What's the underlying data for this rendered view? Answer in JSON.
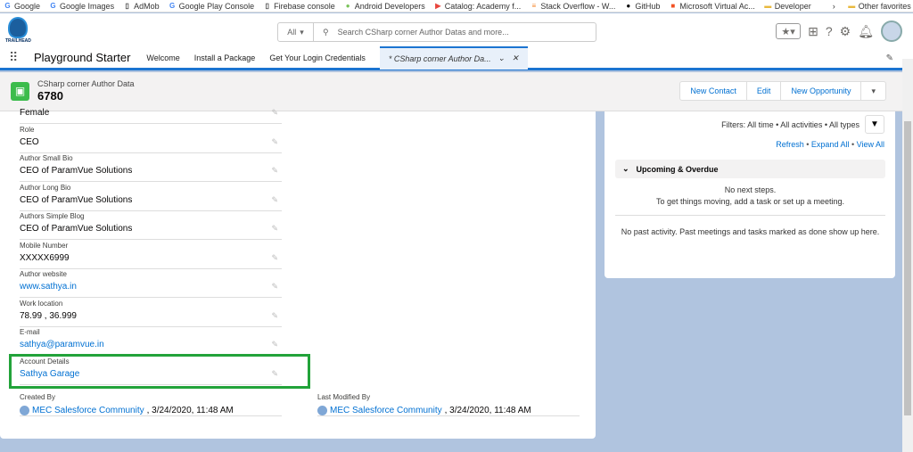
{
  "bookmarks": [
    {
      "icon": "google-icon",
      "label": "Google"
    },
    {
      "icon": "google-icon",
      "label": "Google Images"
    },
    {
      "icon": "page-icon",
      "label": "AdMob"
    },
    {
      "icon": "google-icon",
      "label": "Google Play Console"
    },
    {
      "icon": "page-icon",
      "label": "Firebase console"
    },
    {
      "icon": "android-icon",
      "label": "Android Developers"
    },
    {
      "icon": "play-icon",
      "label": "Catalog: Academy f..."
    },
    {
      "icon": "stackoverflow-icon",
      "label": "Stack Overflow - W..."
    },
    {
      "icon": "github-icon",
      "label": "GitHub"
    },
    {
      "icon": "microsoft-icon",
      "label": "Microsoft Virtual Ac..."
    },
    {
      "icon": "folder-icon",
      "label": "Developer"
    }
  ],
  "other_favorites": "Other favorites",
  "logo_text": "TRAILHEAD",
  "search": {
    "scope": "All",
    "placeholder": "Search CSharp corner Author Datas and more..."
  },
  "nav": {
    "app": "Playground Starter",
    "tabs": [
      "Welcome",
      "Install a Package",
      "Get Your Login Credentials"
    ],
    "active_tab": "* CSharp corner Author Da..."
  },
  "record": {
    "object": "CSharp corner Author Data",
    "name": "6780",
    "actions": [
      "New Contact",
      "Edit",
      "New Opportunity"
    ]
  },
  "fields": [
    {
      "label": "",
      "value": "Female"
    },
    {
      "label": "Role",
      "value": "CEO"
    },
    {
      "label": "Author Small Bio",
      "value": "CEO of ParamVue Solutions"
    },
    {
      "label": "Author Long Bio",
      "value": "CEO of ParamVue Solutions"
    },
    {
      "label": "Authors Simple Blog",
      "value": "CEO of ParamVue Solutions"
    },
    {
      "label": "Mobile Number",
      "value": "XXXXX6999"
    },
    {
      "label": "Author website",
      "value": "www.sathya.in"
    },
    {
      "label": "Work location",
      "value": "78.99 , 36.999"
    },
    {
      "label": "E-mail",
      "value": "sathya@paramvue.in"
    },
    {
      "label": "Account Details",
      "value": "Sathya Garage"
    }
  ],
  "created": {
    "label": "Created By",
    "user": "MEC Salesforce Community",
    "date": ", 3/24/2020, 11:48 AM"
  },
  "modified": {
    "label": "Last Modified By",
    "user": "MEC Salesforce Community",
    "date": ", 3/24/2020, 11:48 AM"
  },
  "activity": {
    "filters": "Filters: All time • All activities • All types",
    "refresh": "Refresh",
    "expand": "Expand All",
    "view_all": "View All",
    "section": "Upcoming & Overdue",
    "no_next": "No next steps.",
    "no_next_sub": "To get things moving, add a task or set up a meeting.",
    "no_past": "No past activity. Past meetings and tasks marked as done show up here."
  }
}
